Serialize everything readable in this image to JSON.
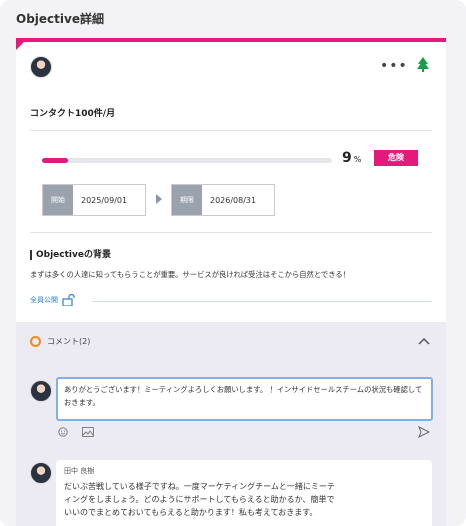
{
  "page": {
    "title": "Objective詳細"
  },
  "objective": {
    "name": "コンタクト100件/月",
    "progress_percent": 9,
    "percent_unit": "%",
    "status": "危険",
    "start_label": "開始",
    "start_date": "2025/09/01",
    "due_label": "期限",
    "due_date": "2026/08/31",
    "background_title": "Objectiveの背景",
    "background_text": "まずは多くの人達に知ってもらうことが重要。サービスが良ければ受注はそこから自然とできる！",
    "visibility": "全員公開"
  },
  "comments": {
    "title": "コメント(2)",
    "reply_value": "ありがとうございます！ミーティングよろしくお願いします。 ！インサイドセールスチームの状況も確認しておきます。",
    "items": [
      {
        "author": "田中 良樹",
        "lines": [
          "だいぶ苦戦している様子ですね。一度マーケティングチームと一緒にミーテ",
          "ィングをしましょう。どのようにサポートしてもらえると助かるか、簡単で",
          "いいのでまとめておいてもらえると助かります！私も考えておきます。"
        ]
      }
    ]
  },
  "colors": {
    "accent": "#e4197c",
    "link": "#2f7fd1",
    "tree": "#1a9c4a",
    "comment_icon": "#f0891e"
  },
  "icons": [
    "avatar",
    "more-icon",
    "tree-icon",
    "lock-icon",
    "comment-icon",
    "chevron-up-icon",
    "emoji-icon",
    "image-icon",
    "send-icon"
  ]
}
